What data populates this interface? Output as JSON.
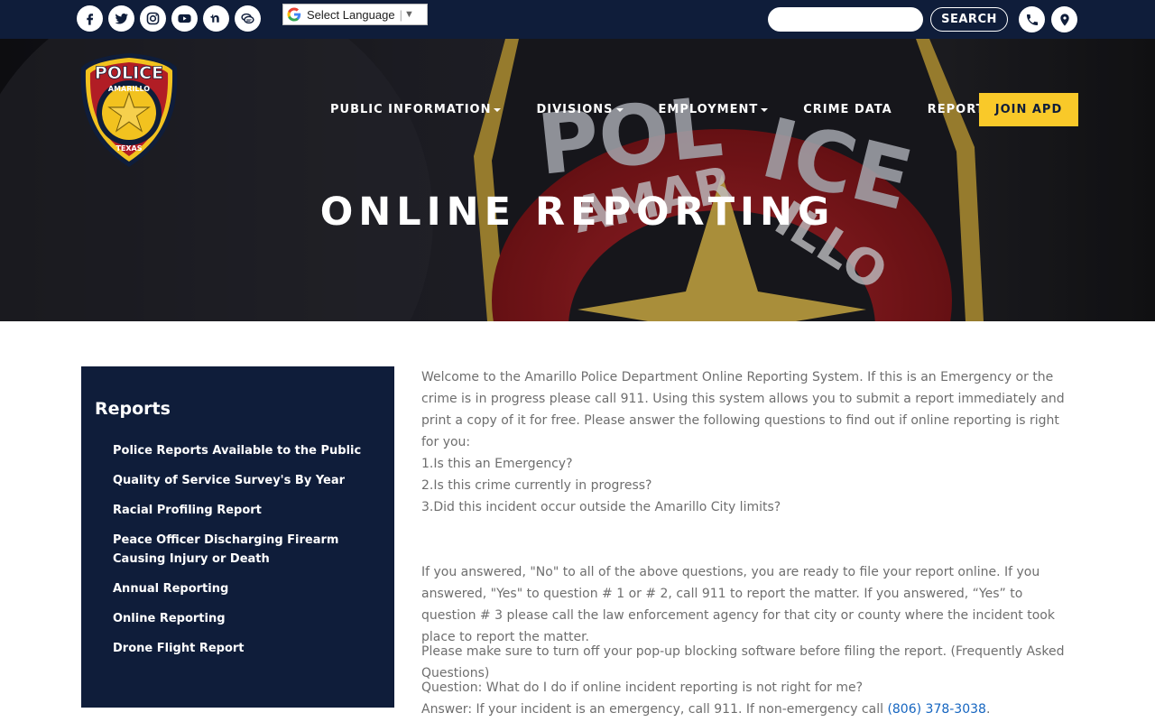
{
  "topbar": {
    "social_icons": [
      "facebook-icon",
      "twitter-icon",
      "instagram-icon",
      "youtube-icon",
      "nextdoor-icon",
      "chat-icon"
    ],
    "translate_label": "Select Language",
    "search_placeholder": "",
    "search_label": "SEARCH",
    "contact_icons": [
      "phone-icon",
      "location-pin-icon"
    ]
  },
  "logo": {
    "top_text": "POLICE",
    "city_text": "AMARILLO",
    "state_text": "TEXAS"
  },
  "nav": {
    "items": [
      {
        "label": "PUBLIC INFORMATION",
        "dropdown": true
      },
      {
        "label": "DIVISIONS",
        "dropdown": true
      },
      {
        "label": "EMPLOYMENT",
        "dropdown": true
      },
      {
        "label": "CRIME DATA",
        "dropdown": false
      },
      {
        "label": "REPORTS",
        "dropdown": true
      }
    ],
    "join_label": "JOIN APD"
  },
  "hero": {
    "title": "ONLINE REPORTING"
  },
  "sidebar": {
    "title": "Reports",
    "items": [
      "Police Reports Available to the Public",
      "Quality of Service Survey's By Year",
      "Racial Profiling Report",
      "Peace Officer Discharging Firearm Causing Injury or Death",
      "Annual Reporting",
      "Online Reporting",
      "Drone Flight Report"
    ]
  },
  "content": {
    "intro": "Welcome to the Amarillo Police Department Online Reporting System. If this is an Emergency or the crime is in progress please call 911. Using this system allows you to submit a report immediately and print a copy of it for free. Please answer the following questions to find out if online reporting is right for you:",
    "questions": [
      "1.Is this an Emergency?",
      "2.Is this crime currently in progress?",
      "3.Did this incident occur outside the Amarillo City limits?"
    ],
    "answer_paragraph": "If you answered, \"No\" to all of the above questions, you are ready to file your report online. If you answered, \"Yes\" to question # 1 or # 2, call 911 to report the matter. If you answered, “Yes” to question # 3 please call the law enforcement agency for that city or county where the incident took place to report the matter.",
    "popup_paragraph": "Please make sure to turn off your pop-up blocking software before filing the report. (Frequently Asked Questions)",
    "qa_question": "Question: What do I do if online incident reporting is not right for me?",
    "qa_answer_prefix": "Answer: If your incident is an emergency, call 911. If non-emergency call ",
    "qa_phone": "(806) 378-3038",
    "qa_answer_suffix": "."
  },
  "colors": {
    "navy": "#0f1d3a",
    "gold": "#f9c929",
    "link": "#1565c0"
  }
}
